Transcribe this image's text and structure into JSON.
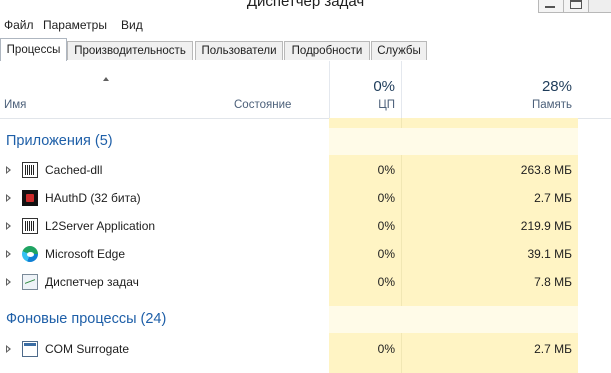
{
  "window": {
    "title": "Диспетчер задач"
  },
  "menu": [
    "Файл",
    "Параметры",
    "Вид"
  ],
  "tabs": [
    {
      "label": "Процессы",
      "active": true
    },
    {
      "label": "Производительность",
      "active": false
    },
    {
      "label": "Пользователи",
      "active": false
    },
    {
      "label": "Подробности",
      "active": false
    },
    {
      "label": "Службы",
      "active": false
    }
  ],
  "columns": {
    "name": "Имя",
    "status": "Состояние",
    "cpu": {
      "percent": "0%",
      "label": "ЦП"
    },
    "memory": {
      "percent": "28%",
      "label": "Память"
    }
  },
  "groups": {
    "apps": "Приложения (5)",
    "background": "Фоновые процессы (24)"
  },
  "processes": [
    {
      "name": "Cached-dll",
      "icon": "exe-icon",
      "cpu": "0%",
      "memory": "263.8 МБ"
    },
    {
      "name": "HAuthD (32 бита)",
      "icon": "hauthd-icon",
      "cpu": "0%",
      "memory": "2.7 МБ"
    },
    {
      "name": "L2Server Application",
      "icon": "exe-icon",
      "cpu": "0%",
      "memory": "219.9 МБ"
    },
    {
      "name": "Microsoft Edge",
      "icon": "edge-icon",
      "cpu": "0%",
      "memory": "39.1 МБ"
    },
    {
      "name": "Диспетчер задач",
      "icon": "task-manager-icon",
      "cpu": "0%",
      "memory": "7.8 МБ"
    },
    {
      "name": "COM Surrogate",
      "icon": "com-surrogate-icon",
      "cpu": "0%",
      "memory": "2.7 МБ"
    }
  ],
  "colors": {
    "group_title": "#1e5fa8",
    "highlight": "#fff4c4",
    "header_text": "#4c607a"
  }
}
